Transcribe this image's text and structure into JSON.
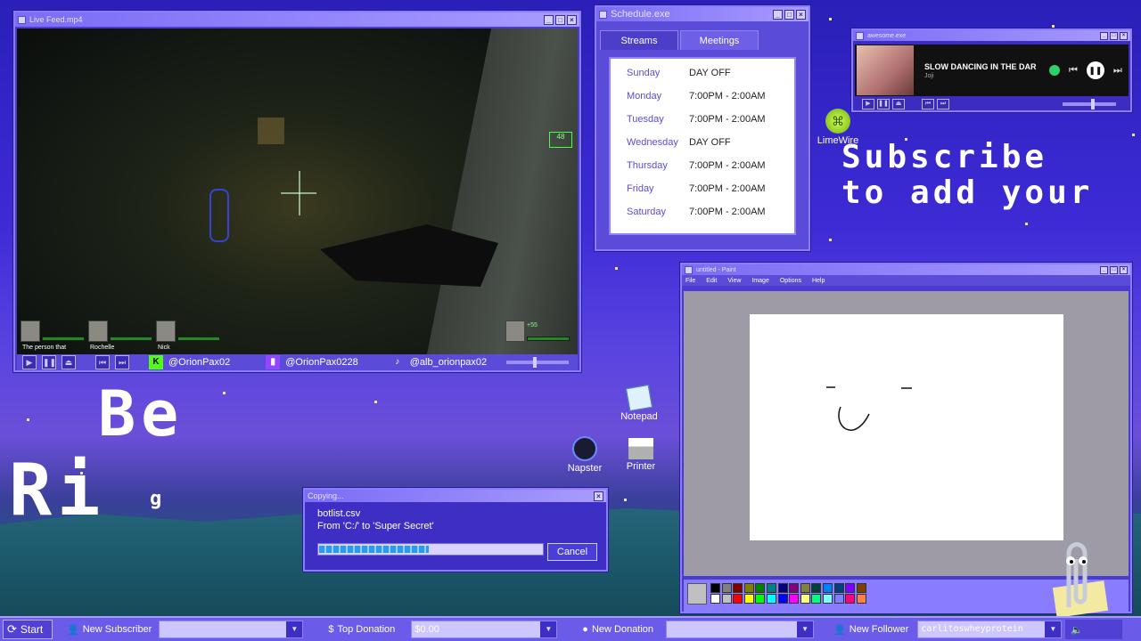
{
  "live": {
    "title": "Live Feed.mp4",
    "players": [
      "The person that",
      "Rochelle",
      "Nick"
    ],
    "ammo": "48",
    "health": "+55",
    "socials": [
      {
        "icon": "kick-icon",
        "handle": "@OrionPax02"
      },
      {
        "icon": "twitch-icon",
        "handle": "@OrionPax0228"
      },
      {
        "icon": "tiktok-icon",
        "handle": "@alb_orionpax02"
      }
    ]
  },
  "schedule": {
    "title": "Schedule.exe",
    "tabs": [
      "Streams",
      "Meetings"
    ],
    "rows": [
      {
        "day": "Sunday",
        "time": "DAY OFF"
      },
      {
        "day": "Monday",
        "time": "7:00PM - 2:00AM"
      },
      {
        "day": "Tuesday",
        "time": "7:00PM - 2:00AM"
      },
      {
        "day": "Wednesday",
        "time": "DAY OFF"
      },
      {
        "day": "Thursday",
        "time": "7:00PM - 2:00AM"
      },
      {
        "day": "Friday",
        "time": "7:00PM - 2:00AM"
      },
      {
        "day": "Saturday",
        "time": "7:00PM - 2:00AM"
      }
    ]
  },
  "music": {
    "title": "awesome.exe",
    "track": "SLOW DANCING IN THE DAR",
    "artist": "Joji"
  },
  "desktop": {
    "limewire": "LimeWire",
    "notepad": "Notepad",
    "napster": "Napster",
    "printer": "Printer"
  },
  "bigtext": {
    "line1": "Subscribe",
    "line2": "to add your",
    "be": "Be",
    "ri": "Ri",
    "g": "g"
  },
  "paint": {
    "title": "untitled - Paint",
    "menu": [
      "File",
      "Edit",
      "View",
      "Image",
      "Options",
      "Help"
    ],
    "colors": [
      "#000000",
      "#808080",
      "#800000",
      "#808000",
      "#008000",
      "#008080",
      "#000080",
      "#800080",
      "#808040",
      "#004040",
      "#0080ff",
      "#004080",
      "#8000ff",
      "#804000",
      "#ffffff",
      "#c0c0c0",
      "#ff0000",
      "#ffff00",
      "#00ff00",
      "#00ffff",
      "#0000ff",
      "#ff00ff",
      "#ffff80",
      "#00ff80",
      "#80ffff",
      "#8080ff",
      "#ff0080",
      "#ff8040"
    ]
  },
  "copy": {
    "title": "Copying...",
    "file": "botlist.csv",
    "route": "From 'C:/' to 'Super Secret'",
    "progress": 0.49,
    "cancel": "Cancel"
  },
  "taskbar": {
    "start": "Start",
    "subscriber_label": "New Subscriber",
    "subscriber_value": "",
    "top_donation_label": "Top Donation",
    "top_donation_value": "$0.00",
    "donation_label": "New Donation",
    "donation_value": "",
    "follower_label": "New Follower",
    "follower_value": "carlitoswheyprotein"
  }
}
